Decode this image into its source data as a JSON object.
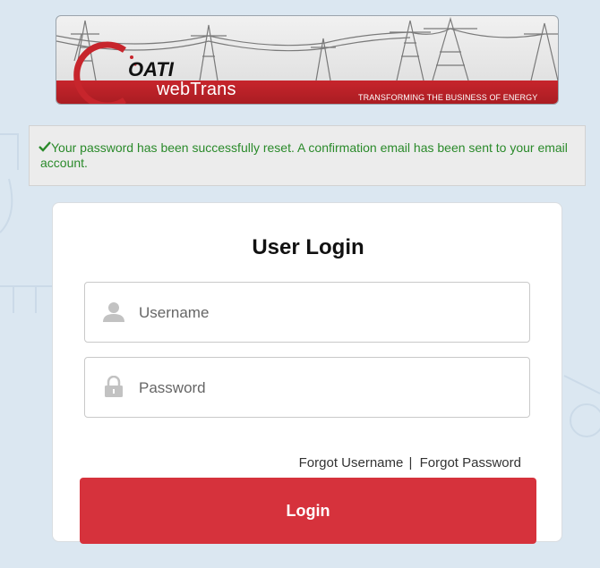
{
  "banner": {
    "logo_text": "OATI",
    "brand": "webTrans",
    "tagline": "TRANSFORMING THE BUSINESS OF ENERGY"
  },
  "alert": {
    "icon": "checkmark-icon",
    "message": "Your password has been successfully reset. A confirmation email has been sent to your email account."
  },
  "login": {
    "title": "User Login",
    "username_placeholder": "Username",
    "password_placeholder": "Password",
    "forgot_username": "Forgot Username",
    "separator": "|",
    "forgot_password": "Forgot Password",
    "button_label": "Login"
  },
  "colors": {
    "brand_red": "#c7252c",
    "button_red": "#d6323c",
    "success_green": "#2a8a2a",
    "background": "#dbe7f1"
  }
}
